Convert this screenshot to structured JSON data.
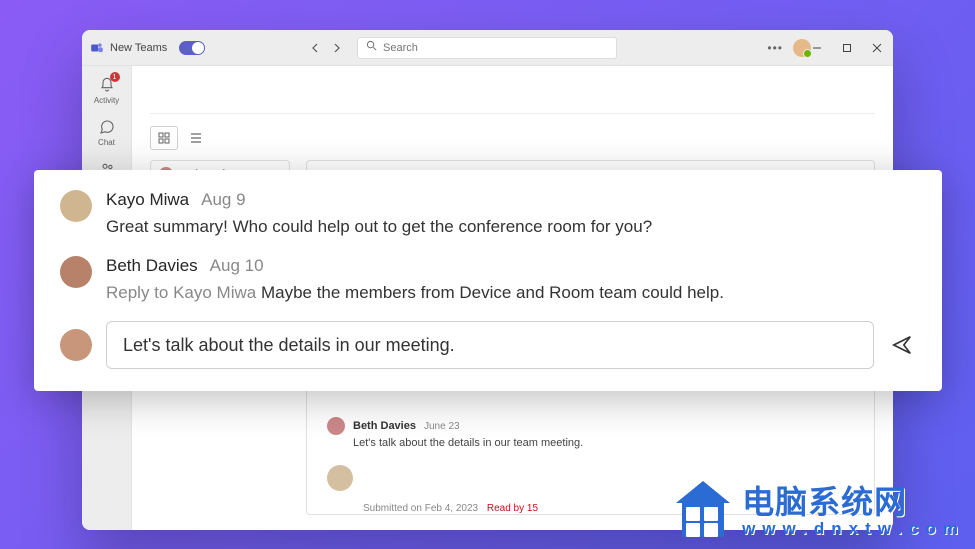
{
  "window": {
    "title": "New Teams",
    "search_placeholder": "Search"
  },
  "rail": {
    "activity": "Activity",
    "activity_badge": "1",
    "chat": "Chat",
    "teams": "Teams"
  },
  "side_panel": {
    "card_name": "Beth Davies"
  },
  "overlay": {
    "msg1": {
      "author": "Kayo Miwa",
      "date": "Aug 9",
      "body": "Great summary! Who could help out to get the conference room for you?"
    },
    "msg2": {
      "author": "Beth Davies",
      "date": "Aug 10",
      "reply_prefix": "Reply to Kayo Miwa",
      "body": " Maybe the members from Device and Room team could help."
    },
    "compose_text": "Let's talk about the details in our meeting."
  },
  "post": {
    "author": "Beth Davies",
    "date": "June 23",
    "body": "Let's talk about the details in our team meeting."
  },
  "footer": {
    "submitted": "Submitted on Feb 4, 2023",
    "read_by": "Read by 15"
  },
  "watermark": {
    "cn": "电脑系统网",
    "url": "www.dnxtw.com"
  }
}
